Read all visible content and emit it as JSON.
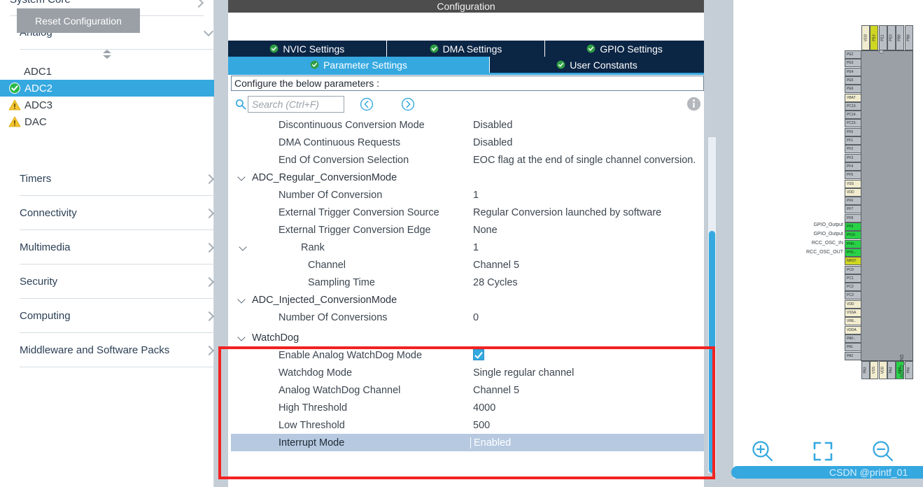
{
  "sidebar": {
    "categories": [
      {
        "label": "System Core",
        "state": "collapsed",
        "icon": "chevron-right-icon"
      },
      {
        "label": "Analog",
        "state": "expanded",
        "icon": "chevron-down-icon"
      },
      {
        "label": "Timers",
        "state": "collapsed",
        "icon": "chevron-right-icon"
      },
      {
        "label": "Connectivity",
        "state": "collapsed",
        "icon": "chevron-right-icon"
      },
      {
        "label": "Multimedia",
        "state": "collapsed",
        "icon": "chevron-right-icon"
      },
      {
        "label": "Security",
        "state": "collapsed",
        "icon": "chevron-right-icon"
      },
      {
        "label": "Computing",
        "state": "collapsed",
        "icon": "chevron-right-icon"
      },
      {
        "label": "Middleware and Software Packs",
        "state": "collapsed",
        "icon": "chevron-right-icon"
      }
    ],
    "peripherals": [
      {
        "label": "ADC1",
        "icon": "none",
        "selected": false
      },
      {
        "label": "ADC2",
        "icon": "check-icon",
        "selected": true
      },
      {
        "label": "ADC3",
        "icon": "warning-icon",
        "selected": false
      },
      {
        "label": "DAC",
        "icon": "warning-icon",
        "selected": false
      }
    ],
    "sort_handle_icon": "sort-updown-icon"
  },
  "center": {
    "title": "Configuration",
    "reset_button": "Reset Configuration",
    "tabs_row1": [
      {
        "label": "NVIC Settings",
        "icon": "green-check-icon",
        "active": false
      },
      {
        "label": "DMA Settings",
        "icon": "green-check-icon",
        "active": false
      },
      {
        "label": "GPIO Settings",
        "icon": "green-check-icon",
        "active": false
      }
    ],
    "tabs_row2": [
      {
        "label": "Parameter Settings",
        "icon": "green-check-icon",
        "active": true
      },
      {
        "label": "User Constants",
        "icon": "green-check-icon",
        "active": false
      }
    ],
    "hint": "Configure the below parameters :",
    "search": {
      "placeholder": "Search (Ctrl+F)",
      "value": ""
    },
    "nav_prev_icon": "chevron-left-circle-icon",
    "nav_next_icon": "chevron-right-circle-icon",
    "info_icon": "info-icon",
    "parameters": [
      {
        "name": "Discontinuous Conversion Mode",
        "value": "Disabled",
        "indent": 1,
        "group": false,
        "twisty": false,
        "selected": false
      },
      {
        "name": "DMA Continuous Requests",
        "value": "Disabled",
        "indent": 1,
        "group": false,
        "twisty": false,
        "selected": false
      },
      {
        "name": "End Of Conversion Selection",
        "value": "EOC flag at the end of single channel conversion.",
        "indent": 1,
        "group": false,
        "twisty": false,
        "selected": false
      },
      {
        "name": "ADC_Regular_ConversionMode",
        "value": "",
        "indent": 0,
        "group": true,
        "twisty": true,
        "selected": false
      },
      {
        "name": "Number Of Conversion",
        "value": "1",
        "indent": 1,
        "group": false,
        "twisty": false,
        "selected": false
      },
      {
        "name": "External Trigger Conversion Source",
        "value": "Regular Conversion launched by software",
        "indent": 1,
        "group": false,
        "twisty": false,
        "selected": false
      },
      {
        "name": "External Trigger Conversion Edge",
        "value": "None",
        "indent": 1,
        "group": false,
        "twisty": false,
        "selected": false
      },
      {
        "name": "Rank",
        "value": "1",
        "indent": 2,
        "group": false,
        "twisty": true,
        "selected": false
      },
      {
        "name": "Channel",
        "value": "Channel 5",
        "indent": 3,
        "group": false,
        "twisty": false,
        "selected": false
      },
      {
        "name": "Sampling Time",
        "value": "28 Cycles",
        "indent": 3,
        "group": false,
        "twisty": false,
        "selected": false
      },
      {
        "name": "ADC_Injected_ConversionMode",
        "value": "",
        "indent": 0,
        "group": true,
        "twisty": true,
        "selected": false
      },
      {
        "name": "Number Of Conversions",
        "value": "0",
        "indent": 1,
        "group": false,
        "twisty": false,
        "selected": false
      },
      {
        "name": "WatchDog",
        "value": "",
        "indent": 0,
        "group": true,
        "twisty": true,
        "selected": false
      },
      {
        "name": "Enable Analog WatchDog Mode",
        "value": "",
        "indent": 1,
        "group": false,
        "twisty": false,
        "selected": false,
        "checkbox": true
      },
      {
        "name": "Watchdog Mode",
        "value": "Single regular channel",
        "indent": 1,
        "group": false,
        "twisty": false,
        "selected": false
      },
      {
        "name": "Analog WatchDog Channel",
        "value": "Channel 5",
        "indent": 1,
        "group": false,
        "twisty": false,
        "selected": false
      },
      {
        "name": "High Threshold",
        "value": "4000",
        "indent": 1,
        "group": false,
        "twisty": false,
        "selected": false
      },
      {
        "name": "Low Threshold",
        "value": "500",
        "indent": 1,
        "group": false,
        "twisty": false,
        "selected": false
      },
      {
        "name": "Interrupt Mode",
        "value": "Enabled",
        "indent": 1,
        "group": false,
        "twisty": false,
        "selected": true
      }
    ]
  },
  "chip": {
    "left_pins": [
      {
        "label": "PE2",
        "type": "io"
      },
      {
        "label": "PE3",
        "type": "io"
      },
      {
        "label": "PE4",
        "type": "io"
      },
      {
        "label": "PE5",
        "type": "io"
      },
      {
        "label": "PE6",
        "type": "io"
      },
      {
        "label": "VBAT",
        "type": "pwr"
      },
      {
        "label": "PC13.",
        "type": "io"
      },
      {
        "label": "PC14.",
        "type": "io"
      },
      {
        "label": "PC15.",
        "type": "io"
      },
      {
        "label": "PF0",
        "type": "io"
      },
      {
        "label": "PF1",
        "type": "io"
      },
      {
        "label": "PF2",
        "type": "io"
      },
      {
        "label": "PF3",
        "type": "io"
      },
      {
        "label": "PF4",
        "type": "io"
      },
      {
        "label": "PF5",
        "type": "io"
      },
      {
        "label": "VSS",
        "type": "pwr"
      },
      {
        "label": "VDD",
        "type": "pwr"
      },
      {
        "label": "PF6",
        "type": "io"
      },
      {
        "label": "PF7",
        "type": "io"
      },
      {
        "label": "PF8",
        "type": "io"
      },
      {
        "label": "PF9",
        "type": "grn"
      },
      {
        "label": "PF10",
        "type": "grn"
      },
      {
        "label": "PH0-.",
        "type": "grn"
      },
      {
        "label": "PH1-.",
        "type": "grn"
      },
      {
        "label": "NRST",
        "type": "yel"
      },
      {
        "label": "PC0",
        "type": "io"
      },
      {
        "label": "PC1",
        "type": "io"
      },
      {
        "label": "PC2",
        "type": "io"
      },
      {
        "label": "PC3",
        "type": "io"
      },
      {
        "label": "VDD",
        "type": "pwr"
      },
      {
        "label": "VSSA",
        "type": "pwr"
      },
      {
        "label": "VRE..",
        "type": "pwr"
      },
      {
        "label": "VDDA",
        "type": "pwr"
      },
      {
        "label": "PA0-.",
        "type": "io"
      },
      {
        "label": "PA1",
        "type": "io"
      },
      {
        "label": "PA2",
        "type": "io"
      }
    ],
    "left_signals": [
      {
        "label": "GPIO_Output",
        "pin": "PF9"
      },
      {
        "label": "GPIO_Output",
        "pin": "PF10"
      },
      {
        "label": "RCC_OSC_IN",
        "pin": "PH0-."
      },
      {
        "label": "RCC_OSC_OUT",
        "pin": "PH1-."
      }
    ],
    "top_pins": [
      {
        "label": "VDD",
        "type": "pwr"
      },
      {
        "label": "PE4",
        "type": "yel"
      },
      {
        "label": "PE1",
        "type": "io"
      },
      {
        "label": "PE0",
        "type": "io"
      },
      {
        "label": "PB9",
        "type": "io"
      },
      {
        "label": "PB8",
        "type": "io"
      }
    ],
    "bottom_pins": [
      {
        "label": "PA3",
        "type": "io"
      },
      {
        "label": "VSS",
        "type": "pwr"
      },
      {
        "label": "VDD",
        "type": "pwr"
      },
      {
        "label": "PA4",
        "type": "io"
      },
      {
        "label": "PA5",
        "type": "grn"
      },
      {
        "label": "PA6",
        "type": "io"
      }
    ],
    "bottom_signal": "ADC2_IN5"
  },
  "toolbar": {
    "zoom_in_icon": "zoom-in-icon",
    "zoom_fit_icon": "fit-to-screen-icon",
    "zoom_out_icon": "zoom-out-icon"
  },
  "watermark": "CSDN @printf_01",
  "colors": {
    "accent_blue": "#35a8e0",
    "tab_navy": "#0b2545",
    "selected_row": "#b6c9e0",
    "annotation_red": "#f22222",
    "warning_yellow": "#f4c430",
    "ok_green": "#2db84c"
  }
}
